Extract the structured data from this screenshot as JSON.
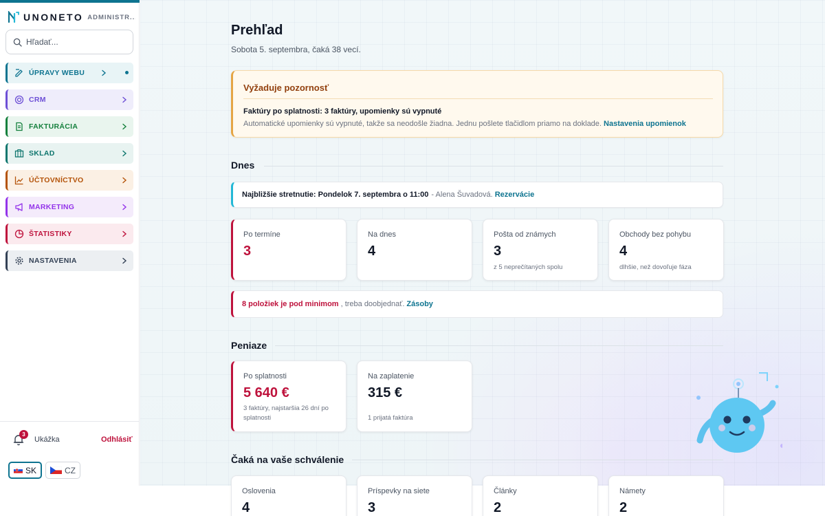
{
  "brand": {
    "name": "UNONETO",
    "sub": "ADMINISTR..."
  },
  "search": {
    "placeholder": "Hľadať..."
  },
  "nav": [
    {
      "label": "ÚPRAVY WEBU",
      "icon": "edit-icon",
      "color": "#0e7490",
      "bg": "#e8f4f6"
    },
    {
      "label": "CRM",
      "icon": "target-icon",
      "color": "#6d4fd6",
      "bg": "#efedfb"
    },
    {
      "label": "FAKTURÁCIA",
      "icon": "document-icon",
      "color": "#15803d",
      "bg": "#e9f5ee"
    },
    {
      "label": "SKLAD",
      "icon": "box-icon",
      "color": "#0f766e",
      "bg": "#e8f3f1"
    },
    {
      "label": "ÚČTOVNÍCTVO",
      "icon": "chart-line-icon",
      "color": "#b45309",
      "bg": "#fbf0e4"
    },
    {
      "label": "MARKETING",
      "icon": "megaphone-icon",
      "color": "#9333ea",
      "bg": "#f4ebfb"
    },
    {
      "label": "ŠTATISTIKY",
      "icon": "pie-chart-icon",
      "color": "#be123c",
      "bg": "#fbeaee"
    },
    {
      "label": "NASTAVENIA",
      "icon": "gear-icon",
      "color": "#334155",
      "bg": "#eceff2"
    }
  ],
  "footer": {
    "notif_count": "3",
    "demo": "Ukážka",
    "logout": "Odhlásiť",
    "lang_sk": "SK",
    "lang_cz": "CZ"
  },
  "page": {
    "title": "Prehľad",
    "subtitle": "Sobota 5. septembra, čaká 38 vecí."
  },
  "alert": {
    "title": "Vyžaduje pozornosť",
    "headline": "Faktúry po splatnosti: 3 faktúry, upomienky sú vypnuté",
    "text": "Automatické upomienky sú vypnuté, takže sa neodošle žiadna. Jednu pošlete tlačidlom priamo na doklade.",
    "link": "Nastavenia upomienok"
  },
  "today": {
    "title": "Dnes",
    "meeting": {
      "bold": "Najbližšie stretnutie: Pondelok 7. septembra o 11:00",
      "muted": "- Alena Šuvadová.",
      "link": "Rezervácie"
    },
    "cards": [
      {
        "label": "Po termíne",
        "value": "3",
        "note": ""
      },
      {
        "label": "Na dnes",
        "value": "4",
        "note": ""
      },
      {
        "label": "Pošta od známych",
        "value": "3",
        "note": "z 5 neprečítaných spolu"
      },
      {
        "label": "Obchody bez pohybu",
        "value": "4",
        "note": "dlhšie, než dovoľuje fáza"
      }
    ],
    "stock": {
      "red": "8 položiek je pod minimom",
      "muted": ", treba doobjednať.",
      "link": "Zásoby"
    }
  },
  "money": {
    "title": "Peniaze",
    "cards": [
      {
        "label": "Po splatnosti",
        "value": "5 640 €",
        "note": "3 faktúry, najstaršia 26 dní po splatnosti"
      },
      {
        "label": "Na zaplatenie",
        "value": "315 €",
        "note": "1 prijatá faktúra"
      }
    ]
  },
  "approval": {
    "title": "Čaká na vaše schválenie",
    "cards": [
      {
        "label": "Oslovenia",
        "value": "4"
      },
      {
        "label": "Príspevky na siete",
        "value": "3"
      },
      {
        "label": "Články",
        "value": "2"
      },
      {
        "label": "Námety",
        "value": "2"
      }
    ]
  }
}
